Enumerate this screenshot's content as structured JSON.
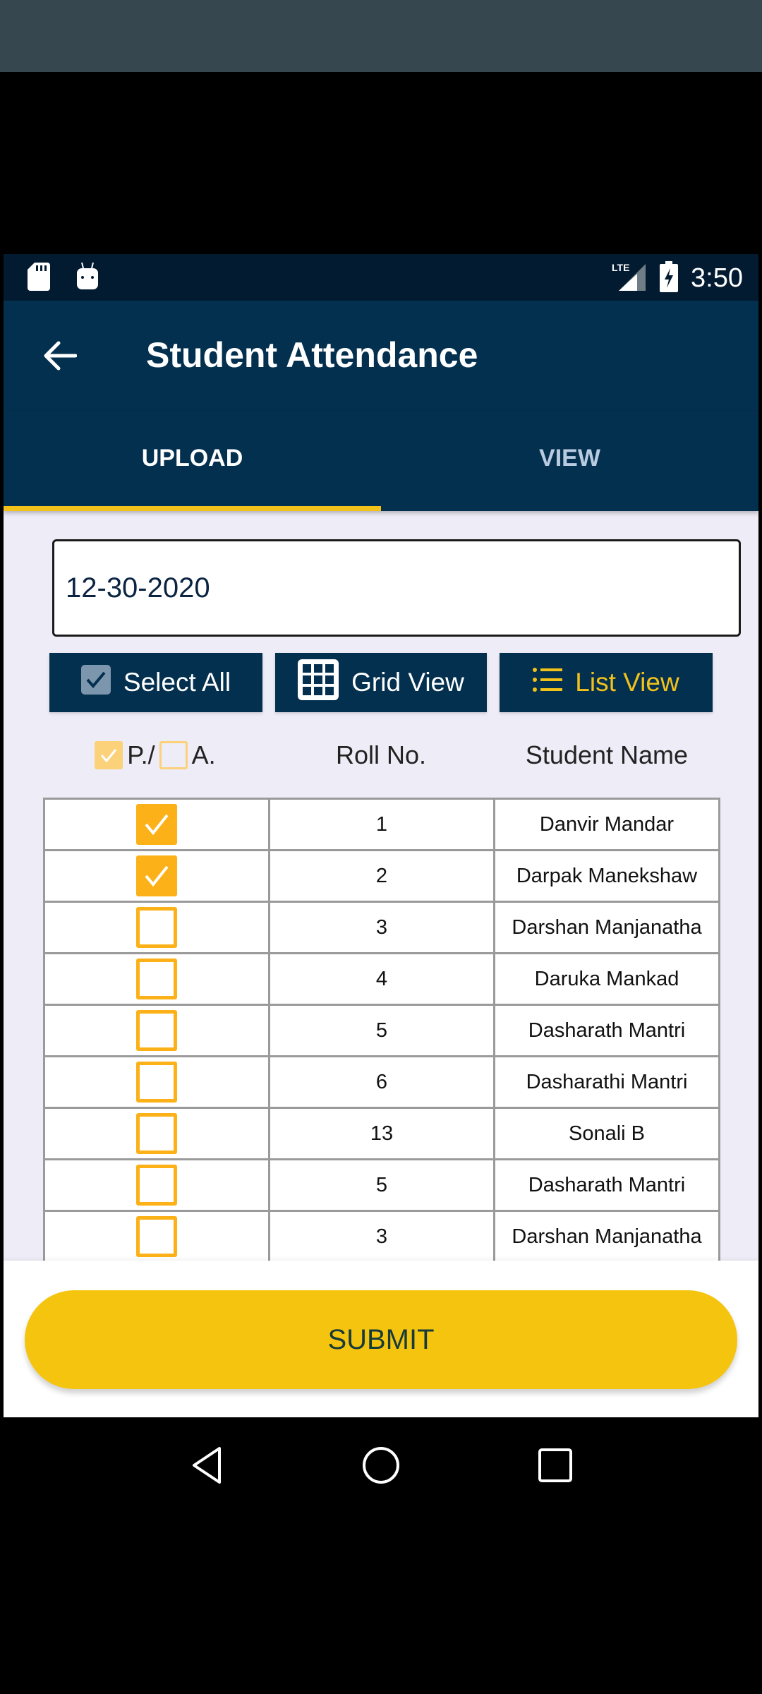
{
  "status_bar": {
    "time": "3:50",
    "network": "LTE",
    "left_icons": [
      "sd-card-icon",
      "android-debug-icon"
    ],
    "right_icons": [
      "lte-signal-icon",
      "battery-charging-icon"
    ]
  },
  "app_bar": {
    "title": "Student Attendance",
    "back_icon": "arrow-back-icon"
  },
  "tabs": [
    {
      "label": "UPLOAD",
      "active": true
    },
    {
      "label": "VIEW",
      "active": false
    }
  ],
  "date_field": {
    "value": "12-30-2020"
  },
  "toolbar": {
    "select_all_label": "Select All",
    "grid_view_label": "Grid View",
    "list_view_label": "List View"
  },
  "table_header": {
    "present_label": "P./",
    "absent_label": "A.",
    "roll_no": "Roll No.",
    "student_name": "Student Name"
  },
  "students": [
    {
      "present": true,
      "roll": "1",
      "name": "Danvir Mandar"
    },
    {
      "present": true,
      "roll": "2",
      "name": "Darpak Manekshaw"
    },
    {
      "present": false,
      "roll": "3",
      "name": "Darshan Manjanatha"
    },
    {
      "present": false,
      "roll": "4",
      "name": "Daruka Mankad"
    },
    {
      "present": false,
      "roll": "5",
      "name": "Dasharath Mantri"
    },
    {
      "present": false,
      "roll": "6",
      "name": "Dasharathi Mantri"
    },
    {
      "present": false,
      "roll": "13",
      "name": "Sonali B"
    },
    {
      "present": false,
      "roll": "5",
      "name": "Dasharath Mantri"
    },
    {
      "present": false,
      "roll": "3",
      "name": "Darshan Manjanatha"
    }
  ],
  "submit_label": "SUBMIT",
  "colors": {
    "primary": "#04304f",
    "accent": "#f3c21a",
    "checkbox": "#fbb117"
  }
}
